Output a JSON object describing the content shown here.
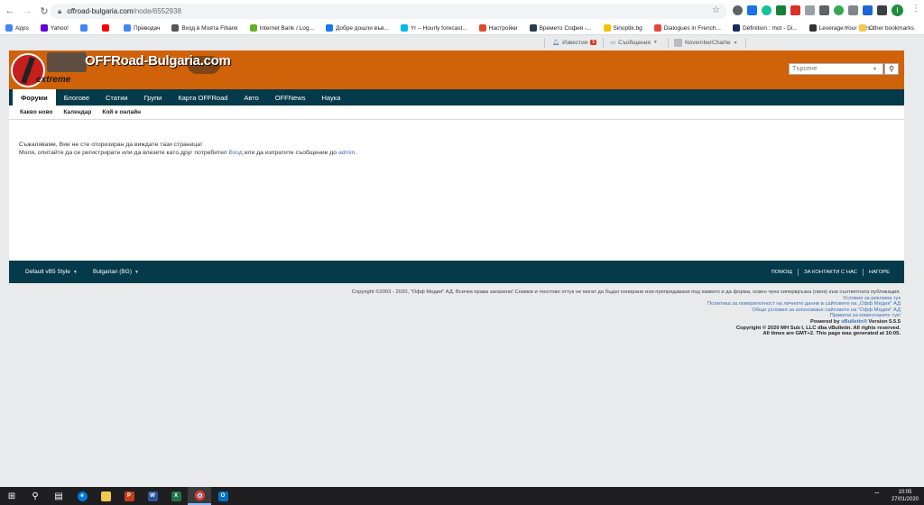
{
  "browser": {
    "url_host": "offroad-bulgaria.com",
    "url_path": "/node/6552938",
    "profile_letter": "I",
    "bookmarks": [
      {
        "label": "Apps",
        "color": "#4285f4"
      },
      {
        "label": "Yahoo!",
        "color": "#6001d2"
      },
      {
        "label": "",
        "color": "#4285f4"
      },
      {
        "label": "",
        "color": "#ff0000"
      },
      {
        "label": "Преводач",
        "color": "#4285f4"
      },
      {
        "label": "Вход в Моята Fibank",
        "color": "#555555"
      },
      {
        "label": "Internet Bank / Log...",
        "color": "#6ab023"
      },
      {
        "label": "Добре дошли във...",
        "color": "#1877f2"
      },
      {
        "label": "Yr – Hourly forecast...",
        "color": "#00b9f1"
      },
      {
        "label": "Настройки",
        "color": "#e0482a"
      },
      {
        "label": "Времето София -...",
        "color": "#2b3b4e"
      },
      {
        "label": "Sinoptik.bg",
        "color": "#f2c300"
      },
      {
        "label": "Dialogues in French...",
        "color": "#e8453c"
      },
      {
        "label": "Définition : mot - Di...",
        "color": "#1a2b5c"
      },
      {
        "label": "Leverage Your Pers...",
        "color": "#333333"
      }
    ],
    "other_bookmarks": "Other bookmarks"
  },
  "topbar": {
    "notifications_label": "Известия",
    "notifications_count": "5",
    "messages_label": "Съобщения",
    "user_name": "NovemberCharlie"
  },
  "header": {
    "logo_text": "OFFRoad-Bulgaria.com",
    "logo_sub": "extreme",
    "search_placeholder": "Търсене"
  },
  "nav": {
    "tabs": [
      "Форуми",
      "Блогове",
      "Статии",
      "Групи",
      "Карта OFFRoad",
      "Авто",
      "OFFNews",
      "Наука"
    ],
    "subnav": [
      "Какво ново",
      "Календар",
      "Кой е онлайн"
    ]
  },
  "content": {
    "line1": "Съжаляваме, Вие не сте оторизиран да виждате тази страница!",
    "line2_a": "Моля, опитайте да се регистрирате или да влезете като друг потребител ",
    "line2_link1": "Вход",
    "line2_b": " или да изпратите съобщение до ",
    "line2_link2": "admin",
    "line2_c": "."
  },
  "footer": {
    "style_select": "Default vB5 Style",
    "lang_select": "Bulgarian (BG)",
    "links": [
      "ПОМОЩ",
      "ЗА КОНТАКТИ С НАС",
      "НАГОРЕ"
    ],
    "copyright": "Copyright ©2003 - 2020, \"Офф Медия\" АД. Всички права запазени! Снимки и текстове оттук не могат да бъдат копирани или препредавани под каквато и да форма, освен чрез хипервръзка (линк) към съответната публикация.",
    "legal_links": [
      "Условия за реклама тук",
      "Политика за поверителност на личните данни в сайтовете на „Офф Медия“ АД",
      "Общи условия за използване сайтовете на \"Офф Медия\" АД",
      "Правила за коментарите тук!"
    ],
    "powered_prefix": "Powered by ",
    "powered_link": "vBulletin®",
    "powered_suffix": " Version 5.5.5",
    "vb_copyright": "Copyright © 2020 MH Sub I, LLC dba vBulletin. All rights reserved.",
    "times": "All times are GMT+2. This page was generated at 10:05."
  },
  "taskbar": {
    "time": "10:05",
    "date": "27/01/2020"
  }
}
